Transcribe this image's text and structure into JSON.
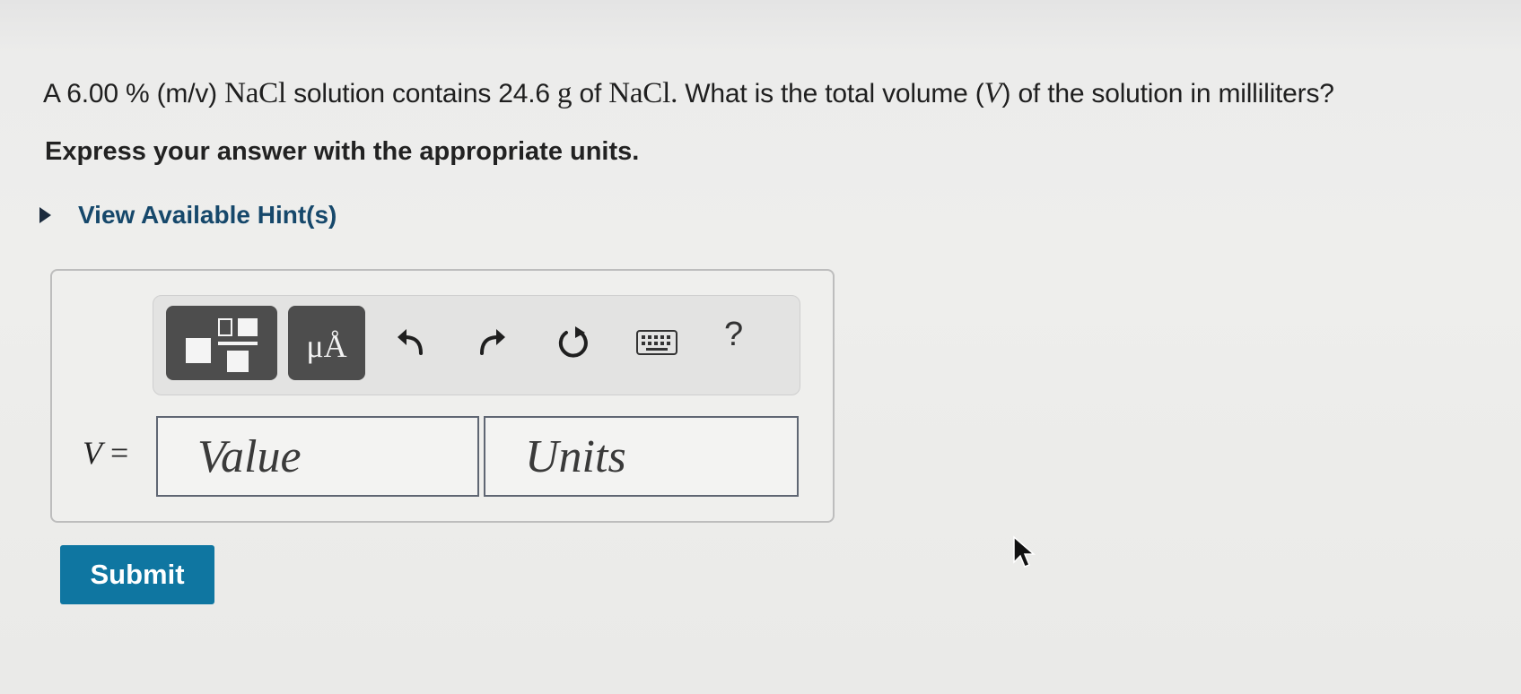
{
  "question": {
    "prefix": "A 6.00 % (m/v) ",
    "compound1": "NaCl",
    "middle": " solution contains 24.6 ",
    "mass_unit": "g",
    "of_text": " of ",
    "compound2": "NaCl.",
    "after": " What is the total volume (",
    "variable": "V",
    "suffix": ") of the solution in milliliters?"
  },
  "instruction": "Express your answer with the appropriate units.",
  "hints": {
    "label": "View Available Hint(s)"
  },
  "toolbar": {
    "units_symbol": "μÅ",
    "help_label": "?",
    "icons": [
      "templates-icon",
      "units-icon",
      "undo-icon",
      "redo-icon",
      "reset-icon",
      "keyboard-icon",
      "help-icon"
    ]
  },
  "answer": {
    "variable": "V",
    "equals": " =",
    "value_placeholder": "Value",
    "units_placeholder": "Units"
  },
  "submit_label": "Submit",
  "colors": {
    "submit": "#0f76a1",
    "hint_link": "#16486b",
    "toolbar_button": "#4d4d4d"
  }
}
